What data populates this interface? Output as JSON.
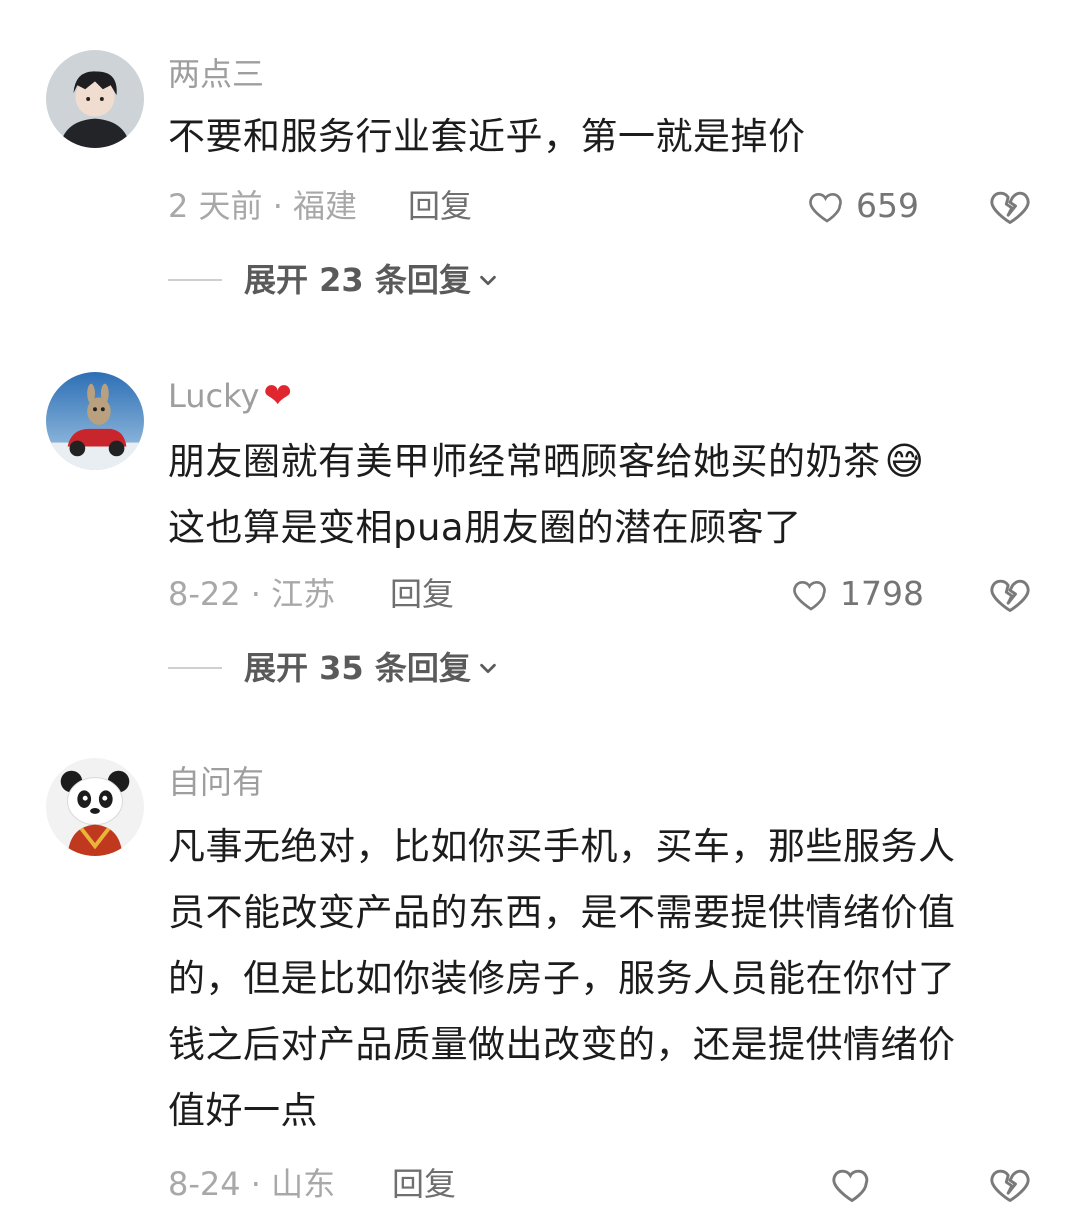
{
  "comments": [
    {
      "username": "两点三",
      "lines": [
        "不要和服务行业套近乎，第一就是掉价"
      ],
      "meta": "2 天前 · 福建",
      "reply_label": "回复",
      "likes": "659",
      "expand_label": "展开 23 条回复",
      "avatar_icon": "boy-avatar-icon"
    },
    {
      "username": "Lucky",
      "lines": [
        "朋友圈就有美甲师经常晒顾客给她买的奶茶",
        "这也算是变相pua朋友圈的潜在顾客了"
      ],
      "emoji": "😅",
      "meta": "8-22 · 江苏",
      "reply_label": "回复",
      "likes": "1798",
      "expand_label": "展开 35 条回复",
      "avatar_icon": "toy-car-avatar-icon"
    },
    {
      "username": "自问有",
      "lines": [
        "凡事无绝对，比如你买手机，买车，那些服务人",
        "员不能改变产品的东西，是不需要提供情绪价值",
        "的，但是比如你装修房子，服务人员能在你付了",
        "钱之后对产品质量做出改变的，还是提供情绪价",
        "值好一点"
      ],
      "meta": "8-24 · 山东",
      "reply_label": "回复",
      "avatar_icon": "panda-avatar-icon"
    }
  ],
  "colors": {
    "heart": "#e0262f",
    "meta": "#a8a8a8",
    "username": "#9e9e9e"
  }
}
